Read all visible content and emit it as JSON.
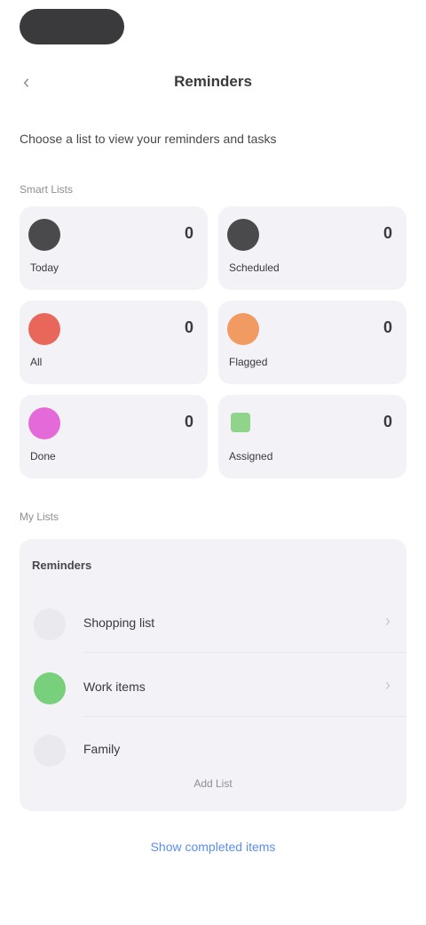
{
  "nav": {
    "back_glyph": "‹",
    "title": "Reminders"
  },
  "subtitle": "Choose a list to view your reminders and tasks",
  "smart_lists": {
    "label": "Smart Lists",
    "tiles": [
      {
        "label": "Today",
        "count": "0",
        "color": "#4a4a4c"
      },
      {
        "label": "Scheduled",
        "count": "0",
        "color": "#4a4a4c"
      },
      {
        "label": "All",
        "count": "0",
        "color": "#e9675a"
      },
      {
        "label": "Flagged",
        "count": "0",
        "color": "#f19a62"
      },
      {
        "label": "Done",
        "count": "0",
        "color": "#e36ad8"
      },
      {
        "label": "Assigned",
        "count": "0",
        "color": "#8fd48a"
      }
    ]
  },
  "my_lists": {
    "label": "My Lists",
    "header": "Reminders",
    "rows": [
      {
        "label": "Shopping list",
        "color": "#e9e9ee"
      },
      {
        "label": "Work items",
        "color": "#79d07c"
      },
      {
        "label": "Family",
        "color": "#e9e9ee"
      }
    ],
    "footer": "Add List"
  },
  "bottom_link": "Show completed items"
}
